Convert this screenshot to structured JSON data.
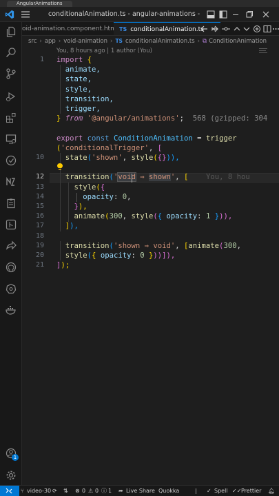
{
  "browser": {
    "tab_title": "AngularAnimations"
  },
  "window": {
    "title": "conditionalAnimation.ts - angular-animations - Visu..."
  },
  "tabs": [
    {
      "label": "oid-animation.component.html"
    },
    {
      "label": "conditionalAnimation.ts",
      "lang_badge": "TS",
      "close": "×"
    }
  ],
  "breadcrumb": {
    "parts": [
      "src",
      "app",
      "void-animation"
    ],
    "file_badge": "TS",
    "file": "conditionalAnimation.ts",
    "symbol": "ConditionAnimation"
  },
  "codelens": "You, 8 hours ago | 1 author (You)",
  "line_numbers": [
    "1",
    "",
    "",
    "",
    "",
    "",
    "",
    "",
    "",
    "",
    "10",
    "",
    "12",
    "13",
    "14",
    "15",
    "16",
    "17",
    "18",
    "19",
    "20",
    "21"
  ],
  "active_line": "12",
  "code": {
    "l1_kw": "import",
    "l1_b": "{",
    "l2": "animate,",
    "l3": "state,",
    "l4": "style,",
    "l5": "transition,",
    "l6": "trigger,",
    "l7_b": "}",
    "l7_from": "from",
    "l7_str": "'@angular/animations'",
    "l7_semi": ";",
    "l7_hint": "568 (gzipped: 304",
    "l9_export": "export",
    "l9_const": "const",
    "l9_name": "ConditionAnimation",
    "l9_eq": "=",
    "l9_fn": "trigger",
    "l10_p": "(",
    "l10_str": "'conditionalTrigger'",
    "l10_rest": ", ",
    "l10_b": "[",
    "l11_fn": "state",
    "l11_p": "(",
    "l11_str": "'shown'",
    "l11_c": ", ",
    "l11_fn2": "style",
    "l11_p2": "(",
    "l11_b": "{}",
    "l11_end": ")),",
    "l12_fn": "transition",
    "l12_p": "(",
    "l12_q": "'",
    "l12_void": "void",
    "l12_arrow": " ⇒ ",
    "l12_shown": "shown",
    "l12_q2": "'",
    "l12_c": ", ",
    "l12_b": "[",
    "l12_blame": "You, 8 hou",
    "l13_fn": "style",
    "l13_p": "(",
    "l13_b": "{",
    "l14_prop": "opacity",
    "l14_col": ": ",
    "l14_num": "0",
    "l14_c": ",",
    "l15_b": "}",
    "l15_end": "),",
    "l16_fn": "animate",
    "l16_p": "(",
    "l16_num": "300",
    "l16_c": ", ",
    "l16_fn2": "style",
    "l16_p2": "(",
    "l16_b1": "{ ",
    "l16_prop": "opacity",
    "l16_col": ": ",
    "l16_num2": "1",
    "l16_b2": " }",
    "l16_end": ")),",
    "l17_b": "]",
    "l17_end": "),",
    "l19_fn": "transition",
    "l19_p": "(",
    "l19_str": "'shown ⇒ void'",
    "l19_c": ", ",
    "l19_b": "[",
    "l19_fn2": "animate",
    "l19_p2": "(",
    "l19_num": "300",
    "l19_c2": ",",
    "l20_fn": "style",
    "l20_p": "(",
    "l20_b1": "{ ",
    "l20_prop": "opacity",
    "l20_col": ": ",
    "l20_num": "0",
    "l20_b2": " }",
    "l20_end": "))]),",
    "l21_b": "]",
    "l21_end": ");"
  },
  "statusbar": {
    "branch": "video-30",
    "errors": "0",
    "warnings": "0",
    "info": "1",
    "live_share": "Live Share",
    "quokka": "Quokka",
    "spell": "Spell",
    "prettier": "Prettier"
  },
  "activity": {
    "account_badge": "1"
  },
  "colors": {
    "accent": "#0078d4",
    "ts": "#3b8eea",
    "keyword": "#c586c0",
    "string": "#ce9178",
    "function": "#dcdcaa",
    "variable": "#9cdcfe",
    "number": "#b5cea8"
  }
}
